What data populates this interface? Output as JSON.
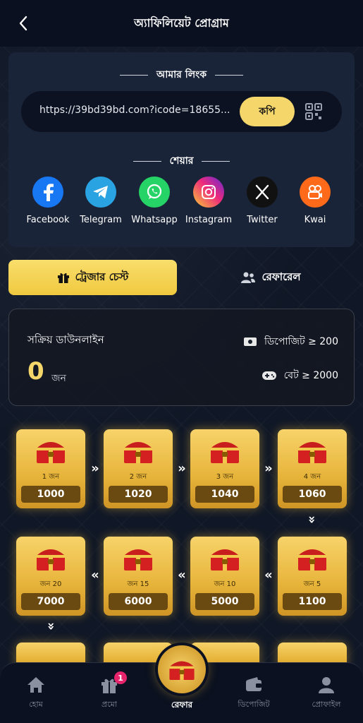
{
  "header": {
    "title": "অ্যাফিলিয়েট প্রোগ্রাম"
  },
  "link_section": {
    "label": "আমার লিংক",
    "url": "https://39bd39bd.com?icode=18655...",
    "copy_label": "কপি"
  },
  "share_section": {
    "label": "শেয়ার",
    "items": [
      {
        "label": "Facebook",
        "icon": "facebook-icon",
        "color": "#1877f2"
      },
      {
        "label": "Telegram",
        "icon": "telegram-icon",
        "color": "#2aa3e2"
      },
      {
        "label": "Whatsapp",
        "icon": "whatsapp-icon",
        "color": "#25d366"
      },
      {
        "label": "Instagram",
        "icon": "instagram-icon",
        "color": "#e1306c"
      },
      {
        "label": "Twitter",
        "icon": "x-icon",
        "color": "#111111"
      },
      {
        "label": "Kwai",
        "icon": "kwai-icon",
        "color": "#ff6a1a"
      }
    ]
  },
  "tabs": {
    "active": "ট্রেজার চেস্ট",
    "inactive": "রেফারেল"
  },
  "downline": {
    "title": "সক্রিয় ডাউনলাইন",
    "count": "0",
    "unit": "জন",
    "deposit_req": "ডিপোজিট ≥ 200",
    "bet_req": "বেট ≥ 2000"
  },
  "chests": [
    {
      "label": "1 জন",
      "amount": "1000"
    },
    {
      "label": "2 জন",
      "amount": "1020"
    },
    {
      "label": "3 জন",
      "amount": "1040"
    },
    {
      "label": "4 জন",
      "amount": "1060"
    },
    {
      "label": "জন 20",
      "amount": "7000"
    },
    {
      "label": "জন 15",
      "amount": "6000"
    },
    {
      "label": "জন 10",
      "amount": "5000"
    },
    {
      "label": "জন 5",
      "amount": "1100"
    }
  ],
  "bottom_nav": {
    "items": [
      {
        "label": "হোম"
      },
      {
        "label": "প্রমো",
        "badge": "1"
      },
      {
        "label": "রেফার"
      },
      {
        "label": "ডিপোজিট"
      },
      {
        "label": "প্রোফাইল"
      }
    ]
  },
  "colors": {
    "accent": "#f5d66b",
    "background": "#101726",
    "card": "#1a2438"
  }
}
